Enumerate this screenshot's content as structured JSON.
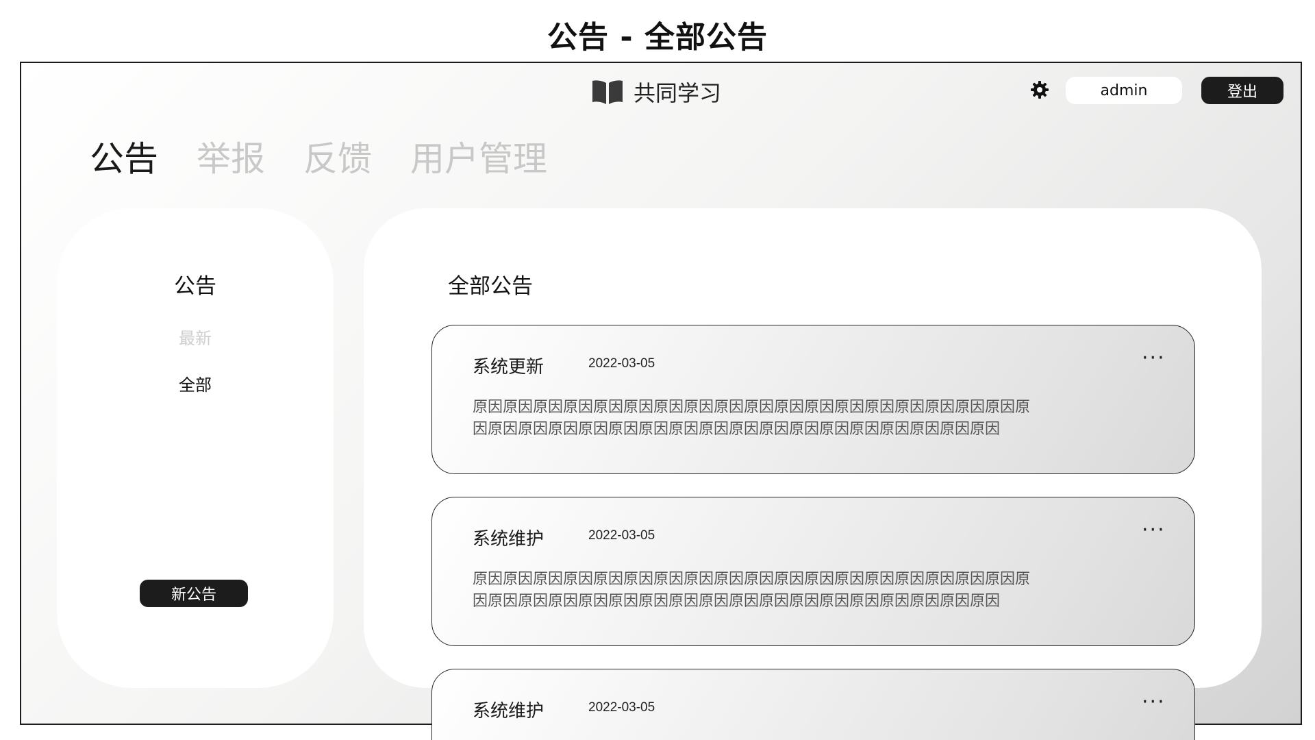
{
  "page_title": "公告 - 全部公告",
  "header": {
    "brand_name": "共同学习",
    "brand_icon": "open-book-icon",
    "settings_icon": "gear-icon",
    "username": "admin",
    "logout_label": "登出"
  },
  "nav": {
    "tabs": [
      {
        "label": "公告",
        "active": true
      },
      {
        "label": "举报",
        "active": false
      },
      {
        "label": "反馈",
        "active": false
      },
      {
        "label": "用户管理",
        "active": false
      }
    ]
  },
  "sidebar": {
    "title": "公告",
    "items": [
      {
        "label": "最新",
        "active": false
      },
      {
        "label": "全部",
        "active": true
      }
    ],
    "new_button_label": "新公告"
  },
  "main": {
    "title": "全部公告",
    "announcements": [
      {
        "title": "系统更新",
        "date": "2022-03-05",
        "more": "···",
        "body": "原因原因原因原因原因原因原因原因原因原因原因原因原因原因原因原因原因原因原因原因原因原因原因原因原因原因原因原因原因原因原因原因原因原因原因原因"
      },
      {
        "title": "系统维护",
        "date": "2022-03-05",
        "more": "···",
        "body": "原因原因原因原因原因原因原因原因原因原因原因原因原因原因原因原因原因原因原因原因原因原因原因原因原因原因原因原因原因原因原因原因原因原因原因原因"
      },
      {
        "title": "系统维护",
        "date": "2022-03-05",
        "more": "···",
        "body": ""
      }
    ]
  },
  "colors": {
    "dark_button": "#1c1c1c",
    "inactive_tab": "#c8c8c8",
    "muted_menu": "#cfcfcf"
  }
}
